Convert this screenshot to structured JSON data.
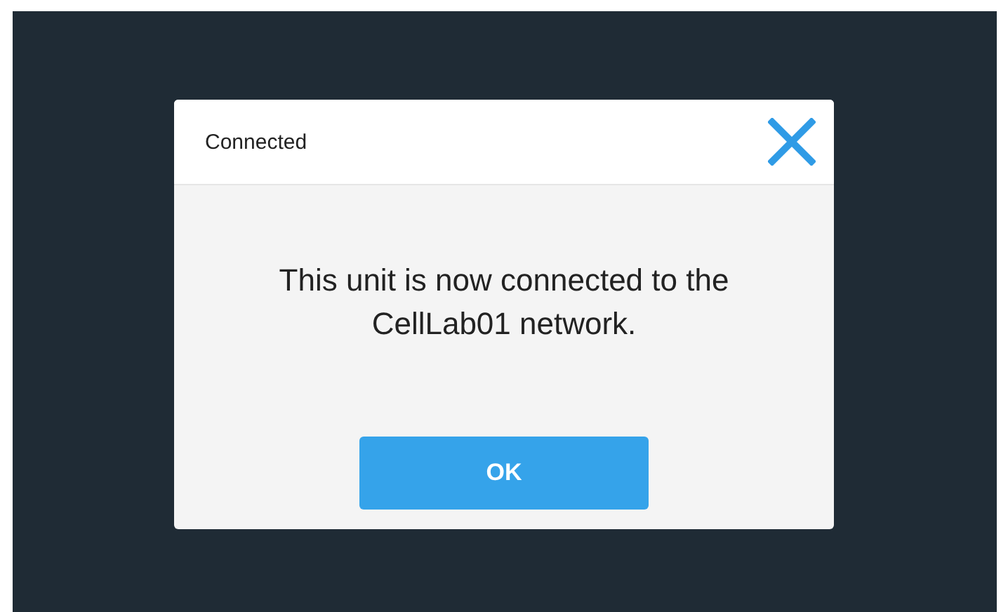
{
  "dialog": {
    "title": "Connected",
    "message": "This unit is now connected to the CellLab01 network.",
    "buttons": [
      "OK"
    ]
  }
}
